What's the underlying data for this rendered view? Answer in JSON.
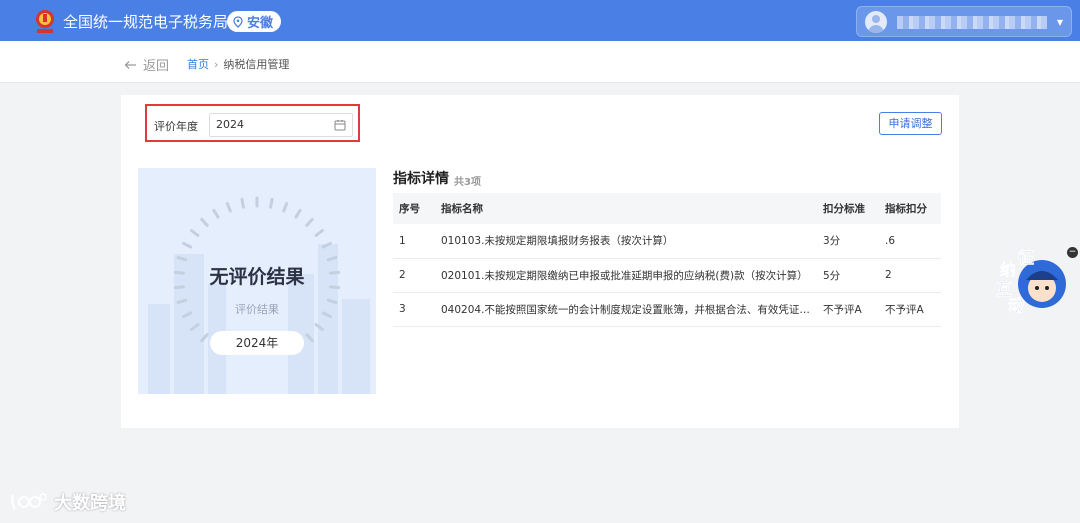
{
  "header": {
    "app_title": "全国统一规范电子税务局",
    "region": "安徽",
    "brand_color": "#4a7fe6"
  },
  "breadcrumb": {
    "back_label": "返回",
    "home": "首页",
    "current": "纳税信用管理"
  },
  "filter": {
    "year_label": "评价年度",
    "year_value": "2024"
  },
  "actions": {
    "apply_adjust": "申请调整"
  },
  "result": {
    "title": "无评价结果",
    "subtitle": "评价结果",
    "year_badge": "2024年"
  },
  "details": {
    "title": "指标详情",
    "count": "共3项",
    "columns": [
      "序号",
      "指标名称",
      "扣分标准",
      "指标扣分"
    ],
    "rows": [
      [
        "1",
        "010103.未按规定期限填报财务报表（按次计算）",
        "3分",
        ".6"
      ],
      [
        "2",
        "020101.未按规定期限缴纳已申报或批准延期申报的应纳税(费)款（按次计算）",
        "5分",
        "2"
      ],
      [
        "3",
        "040204.不能按照国家统一的会计制度规定设置账簿，并根据合法、有效凭证核算...",
        "不予评A",
        "不予评A"
      ]
    ]
  },
  "float_widget": {
    "chars": [
      "征",
      "纳",
      "互",
      "动"
    ]
  },
  "watermark": {
    "text": "大数跨境"
  }
}
